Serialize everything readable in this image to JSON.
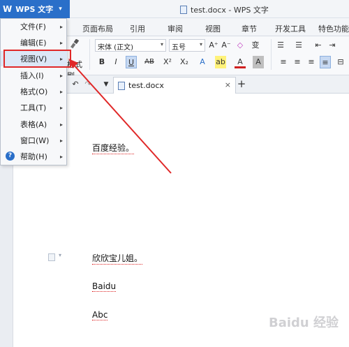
{
  "window": {
    "app_button_label": "WPS 文字",
    "app_logo": "W",
    "title": "test.docx - WPS 文字"
  },
  "ribbon_tabs": [
    "页面布局",
    "引用",
    "审阅",
    "视图",
    "章节",
    "开发工具",
    "特色功能"
  ],
  "ribbon": {
    "format_painter_label": "格式刷",
    "font_name": "宋体 (正文)",
    "font_size": "五号",
    "tool_glyphs": {
      "grow_font": "A⁺",
      "shrink_font": "A⁻",
      "clear_format": "◇",
      "phonetic": "变",
      "bold": "B",
      "italic": "I",
      "underline": "U",
      "strike": "AB",
      "superscript": "X²",
      "subscript": "X₂",
      "text_effect": "A",
      "highlight": "ab",
      "font_color": "A",
      "char_shade": "A"
    }
  },
  "docbar": {
    "tab_label": "test.docx",
    "close_glyph": "×",
    "new_tab_glyph": "+"
  },
  "file_menu": {
    "items": [
      {
        "label": "文件(F)"
      },
      {
        "label": "编辑(E)"
      },
      {
        "label": "视图(V)"
      },
      {
        "label": "插入(I)"
      },
      {
        "label": "格式(O)"
      },
      {
        "label": "工具(T)"
      },
      {
        "label": "表格(A)"
      },
      {
        "label": "窗口(W)"
      },
      {
        "label": "帮助(H)"
      }
    ],
    "highlighted": "视图(V)"
  },
  "document": {
    "paragraphs": [
      "百度经验。",
      "欣欣宝儿姐。",
      "Baidu",
      "Abc"
    ]
  },
  "watermark": "Baidu 经验",
  "colors": {
    "brand_blue": "#2a6fc9",
    "annotation_red": "#e02828"
  }
}
